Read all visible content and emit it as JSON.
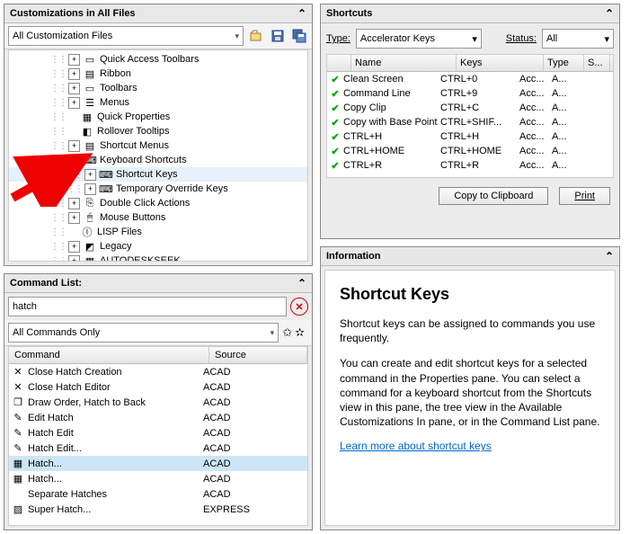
{
  "panels": {
    "customizations": {
      "title": "Customizations in All Files"
    },
    "commandlist": {
      "title": "Command List:"
    },
    "shortcuts": {
      "title": "Shortcuts"
    },
    "information": {
      "title": "Information"
    }
  },
  "custom_combo": "All Customization Files",
  "tree": [
    {
      "level": 1,
      "exp": "+",
      "icon": "qat",
      "label": "Quick Access Toolbars"
    },
    {
      "level": 1,
      "exp": "+",
      "icon": "ribbon",
      "label": "Ribbon"
    },
    {
      "level": 1,
      "exp": "+",
      "icon": "toolbar",
      "label": "Toolbars"
    },
    {
      "level": 1,
      "exp": "+",
      "icon": "menu",
      "label": "Menus"
    },
    {
      "level": 1,
      "exp": "",
      "icon": "qp",
      "label": "Quick Properties"
    },
    {
      "level": 1,
      "exp": "",
      "icon": "tip",
      "label": "Rollover Tooltips"
    },
    {
      "level": 1,
      "exp": "+",
      "icon": "smenu",
      "label": "Shortcut Menus"
    },
    {
      "level": 1,
      "exp": "-",
      "icon": "kb",
      "label": "Keyboard Shortcuts"
    },
    {
      "level": 2,
      "exp": "+",
      "icon": "sk",
      "label": "Shortcut Keys",
      "sel": true
    },
    {
      "level": 2,
      "exp": "+",
      "icon": "tok",
      "label": "Temporary Override Keys"
    },
    {
      "level": 1,
      "exp": "+",
      "icon": "dbl",
      "label": "Double Click Actions"
    },
    {
      "level": 1,
      "exp": "+",
      "icon": "mouse",
      "label": "Mouse Buttons"
    },
    {
      "level": 1,
      "exp": "",
      "icon": "lisp",
      "label": "LISP Files"
    },
    {
      "level": 1,
      "exp": "+",
      "icon": "legacy",
      "label": "Legacy"
    },
    {
      "level": 1,
      "exp": "+",
      "icon": "cui",
      "label": "AUTODESKSEEK"
    }
  ],
  "search_value": "hatch",
  "cmd_combo": "All Commands Only",
  "cmd_cols": {
    "c1": "Command",
    "c2": "Source"
  },
  "commands": [
    {
      "icon": "x",
      "name": "Close Hatch Creation",
      "src": "ACAD"
    },
    {
      "icon": "x",
      "name": "Close Hatch Editor",
      "src": "ACAD"
    },
    {
      "icon": "layers",
      "name": "Draw Order, Hatch to Back",
      "src": "ACAD"
    },
    {
      "icon": "pencil",
      "name": "Edit Hatch",
      "src": "ACAD"
    },
    {
      "icon": "pencil",
      "name": "Hatch Edit",
      "src": "ACAD"
    },
    {
      "icon": "pencil",
      "name": "Hatch Edit...",
      "src": "ACAD"
    },
    {
      "icon": "hatch",
      "name": "Hatch...",
      "src": "ACAD",
      "sel": true
    },
    {
      "icon": "hatch",
      "name": "Hatch...",
      "src": "ACAD"
    },
    {
      "icon": "blank",
      "name": "Separate Hatches",
      "src": "ACAD"
    },
    {
      "icon": "sh",
      "name": "Super Hatch...",
      "src": "EXPRESS"
    }
  ],
  "sc_form": {
    "type_label": "Type:",
    "type_value": "Accelerator Keys",
    "status_label": "Status:",
    "status_value": "All"
  },
  "sc_cols": {
    "name": "Name",
    "keys": "Keys",
    "type": "Type",
    "src": "S..."
  },
  "sc_rows": [
    {
      "name": "Clean Screen",
      "keys": "CTRL+0",
      "type": "Acc...",
      "src": "A..."
    },
    {
      "name": "Command Line",
      "keys": "CTRL+9",
      "type": "Acc...",
      "src": "A..."
    },
    {
      "name": "Copy Clip",
      "keys": "CTRL+C",
      "type": "Acc...",
      "src": "A..."
    },
    {
      "name": "Copy with Base Point",
      "keys": "CTRL+SHIF...",
      "type": "Acc...",
      "src": "A..."
    },
    {
      "name": "CTRL+H",
      "keys": "CTRL+H",
      "type": "Acc...",
      "src": "A..."
    },
    {
      "name": "CTRL+HOME",
      "keys": "CTRL+HOME",
      "type": "Acc...",
      "src": "A..."
    },
    {
      "name": "CTRL+R",
      "keys": "CTRL+R",
      "type": "Acc...",
      "src": "A..."
    }
  ],
  "sc_buttons": {
    "copy": "Copy to Clipboard",
    "print": "Print"
  },
  "info": {
    "heading": "Shortcut Keys",
    "p1": "Shortcut keys can be assigned to commands you use frequently.",
    "p2": "You can create and edit shortcut keys for a selected command in the Properties pane. You can select a command for a keyboard shortcut from the Shortcuts view in this pane, the tree view in the Available Customizations In pane, or in the Command List pane.",
    "link": "Learn more about shortcut keys"
  }
}
